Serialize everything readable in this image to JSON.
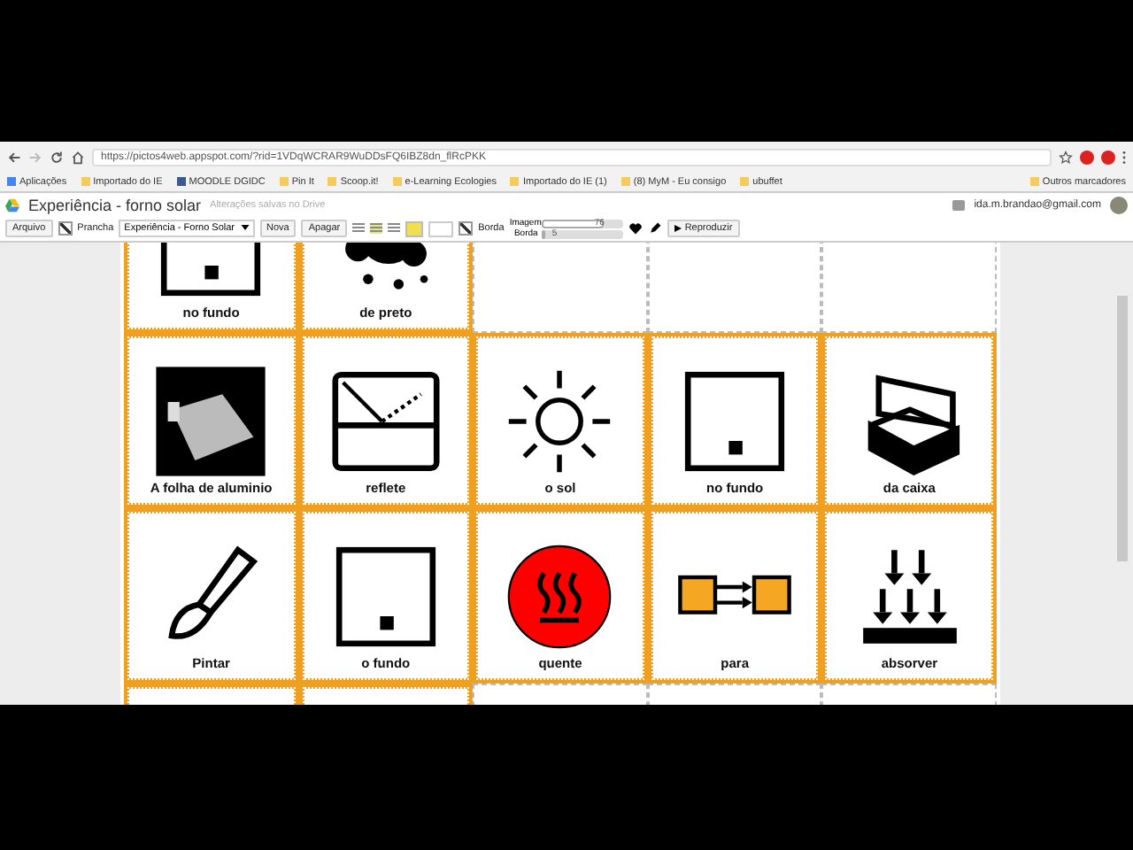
{
  "browser": {
    "url": "https://pictos4web.appspot.com/?rid=1VDqWCRAR9WuDDsFQ6IBZ8dn_flRcPKK",
    "bookmarks": [
      "Aplicações",
      "Importado do IE",
      "MOODLE DGIDC",
      "Pin It",
      "Scoop.it!",
      "e-Learning Ecologies",
      "Importado do IE (1)",
      "(8) MyM - Eu consigo",
      "ubuffet"
    ],
    "other_bookmarks": "Outros marcadores"
  },
  "app": {
    "title": "Experiência - forno solar",
    "save_status": "Alterações salvas no Drive",
    "account": "ida.m.brandao@gmail.com"
  },
  "toolbar": {
    "file_button": "Arquivo",
    "board_checkbox": {
      "label": "Prancha",
      "checked": true
    },
    "board_select": "Experiência - Forno Solar",
    "new_button": "Nova",
    "delete_button": "Apagar",
    "alignments": [
      {
        "selected": false
      },
      {
        "selected": true
      },
      {
        "selected": false
      }
    ],
    "border_checkbox": {
      "label": "Borda",
      "checked": true
    },
    "sliders": [
      {
        "label": "Imagem",
        "level": 0.76,
        "reading": "76"
      },
      {
        "label": "Borda",
        "level": 0.05,
        "reading": "5"
      }
    ],
    "play_button": "Reproduzir"
  },
  "board": {
    "rows": [
      [
        {
          "kind": "symbol",
          "label": "no fundo"
        },
        {
          "kind": "symbol",
          "label": "de preto"
        },
        {
          "kind": "empty"
        },
        {
          "kind": "empty"
        },
        {
          "kind": "empty"
        }
      ],
      [
        {
          "kind": "symbol",
          "label": "A folha de aluminio"
        },
        {
          "kind": "symbol",
          "label": "reflete"
        },
        {
          "kind": "symbol",
          "label": "o sol"
        },
        {
          "kind": "symbol",
          "label": "no fundo"
        },
        {
          "kind": "symbol",
          "label": "da caixa"
        }
      ],
      [
        {
          "kind": "symbol",
          "label": "Pintar"
        },
        {
          "kind": "symbol",
          "label": "o fundo"
        },
        {
          "kind": "symbol",
          "label": "quente"
        },
        {
          "kind": "symbol",
          "label": "para"
        },
        {
          "kind": "symbol",
          "label": "absorver"
        }
      ],
      [
        {
          "kind": "symbol"
        },
        {
          "kind": "symbol"
        },
        {
          "kind": "empty"
        },
        {
          "kind": "empty"
        },
        {
          "kind": "empty"
        }
      ]
    ]
  }
}
